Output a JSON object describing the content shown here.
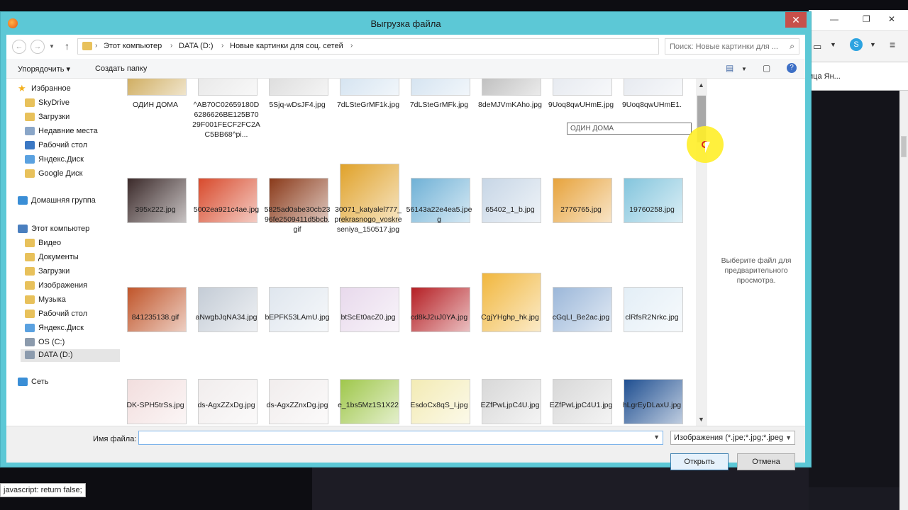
{
  "background_browser": {
    "tab_partial": "ица Ян...",
    "status_text": "javascript: return false;"
  },
  "dialog": {
    "title": "Выгрузка файла",
    "close_glyph": "✕"
  },
  "address_bar": {
    "crumbs": [
      "Этот компьютер",
      "DATA (D:)",
      "Новые картинки для соц. сетей"
    ],
    "search_placeholder": "Поиск: Новые картинки для ..."
  },
  "command_bar": {
    "organize_label": "Упорядочить ▾",
    "new_folder_label": "Создать папку"
  },
  "nav_pane": {
    "items": [
      {
        "label": "Избранное",
        "icon": "star-icon",
        "color": "#f3b01d"
      },
      {
        "label": "SkyDrive",
        "icon": "folder-icon",
        "color": "#e8c15b"
      },
      {
        "label": "Загрузки",
        "icon": "folder-icon",
        "color": "#e8c15b"
      },
      {
        "label": "Недавние места",
        "icon": "recent-places-icon",
        "color": "#8aa6c8"
      },
      {
        "label": "Рабочий стол",
        "icon": "desktop-icon",
        "color": "#3b78c4"
      },
      {
        "label": "Яндекс.Диск",
        "icon": "cloud-icon",
        "color": "#5aa1e0"
      },
      {
        "label": "Google Диск",
        "icon": "folder-icon",
        "color": "#e8c15b"
      },
      {
        "label": "Домашняя группа",
        "icon": "homegroup-icon",
        "color": "#3a8ed6"
      },
      {
        "label": "Этот компьютер",
        "icon": "computer-icon",
        "color": "#4a7fbf"
      },
      {
        "label": "Видео",
        "icon": "folder-icon",
        "color": "#e8c15b"
      },
      {
        "label": "Документы",
        "icon": "folder-icon",
        "color": "#e8c15b"
      },
      {
        "label": "Загрузки",
        "icon": "folder-icon",
        "color": "#e8c15b"
      },
      {
        "label": "Изображения",
        "icon": "folder-icon",
        "color": "#e8c15b"
      },
      {
        "label": "Музыка",
        "icon": "folder-icon",
        "color": "#e8c15b"
      },
      {
        "label": "Рабочий стол",
        "icon": "folder-icon",
        "color": "#e8c15b"
      },
      {
        "label": "Яндекс.Диск",
        "icon": "cloud-icon",
        "color": "#5aa1e0"
      },
      {
        "label": "OS (C:)",
        "icon": "drive-icon",
        "color": "#8c9bad"
      },
      {
        "label": "DATA (D:)",
        "icon": "drive-icon",
        "color": "#8c9bad"
      },
      {
        "label": "Сеть",
        "icon": "network-icon",
        "color": "#3a8ed6"
      }
    ]
  },
  "files": {
    "row1": [
      {
        "name": "ОДИН ДОМА",
        "color": "#c9a24a"
      },
      {
        "name": "^AB70C02659180D6286626BE125B7029F001FECF2FC2AC5BB68^pi...",
        "color": "#e6e6e6"
      },
      {
        "name": "5Sjq-wDsJF4.jpg",
        "color": "#d9d9d9"
      },
      {
        "name": "7dLSteGrMF1k.jpg",
        "color": "#cfe0ef"
      },
      {
        "name": "7dLSteGrMFk.jpg",
        "color": "#cfe0ef"
      },
      {
        "name": "8deMJVmKAho.jpg",
        "color": "#b7b7b7"
      },
      {
        "name": "9Uoq8qwUHmE.jpg",
        "color": "#e3e7ee"
      },
      {
        "name": "9Uoq8qwUHmE1.",
        "color": "#e3e7ee"
      }
    ],
    "row2": [
      {
        "name": "395x222.jpg",
        "color": "#3b2a2a"
      },
      {
        "name": "5002ea921c4ae.jpg",
        "color": "#d84a2c"
      },
      {
        "name": "5825ad0abe30cb2396fe2509411d5bcb.gif",
        "color": "#8a3a1a"
      },
      {
        "name": "30071_katyalel777_prekrasnogo_voskreseniya_150517.jpg",
        "color": "#e0a22a"
      },
      {
        "name": "56143a22e4ea5.jpeg",
        "color": "#6fb1d6"
      },
      {
        "name": "65402_1_b.jpg",
        "color": "#c7d6e6"
      },
      {
        "name": "2776765.jpg",
        "color": "#e7a33c"
      },
      {
        "name": "19760258.jpg",
        "color": "#83c5dd"
      }
    ],
    "row3": [
      {
        "name": "841235138.gif",
        "color": "#c0552a"
      },
      {
        "name": "aNwgbJqNA34.jpg",
        "color": "#c4ccd6"
      },
      {
        "name": "bEPFK53LAmU.jpg",
        "color": "#dfe6ee"
      },
      {
        "name": "btScEt0acZ0.jpg",
        "color": "#e8d9ec"
      },
      {
        "name": "cd8kJ2uJ0YA.jpg",
        "color": "#b51f24"
      },
      {
        "name": "CgjYHghp_hk.jpg",
        "color": "#f1b73e"
      },
      {
        "name": "cGqLI_Be2ac.jpg",
        "color": "#9bb7d9"
      },
      {
        "name": "clRfsR2Nrkc.jpg",
        "color": "#e3eef6"
      }
    ],
    "row4": [
      {
        "name": "DK-SPH5trSs.jpg",
        "color": "#f2dede"
      },
      {
        "name": "ds-AgxZZxDg.jpg",
        "color": "#f1eded"
      },
      {
        "name": "ds-AgxZZnxDg.jpg",
        "color": "#f1eded"
      },
      {
        "name": "e_1bs5Mz1S1X22",
        "color": "#9fc74b"
      },
      {
        "name": "EsdoCx8qS_I.jpg",
        "color": "#f3ebb4"
      },
      {
        "name": "EZfPwLjpC4U.jpg",
        "color": "#d8d8d8"
      },
      {
        "name": "EZfPwLjpC4U1.jpg",
        "color": "#d8d8d8"
      },
      {
        "name": "hLgrEyDLaxU.jpg",
        "color": "#1f4f91"
      }
    ]
  },
  "tooltip": "ОДИН ДОМА",
  "preview_text": "Выберите файл для предварительного просмотра.",
  "footer": {
    "filename_label": "Имя файла:",
    "filename_value": "",
    "filetype_value": "Изображения (*.jpe;*.jpg;*.jpeg",
    "open_label": "Открыть",
    "cancel_label": "Отмена"
  }
}
